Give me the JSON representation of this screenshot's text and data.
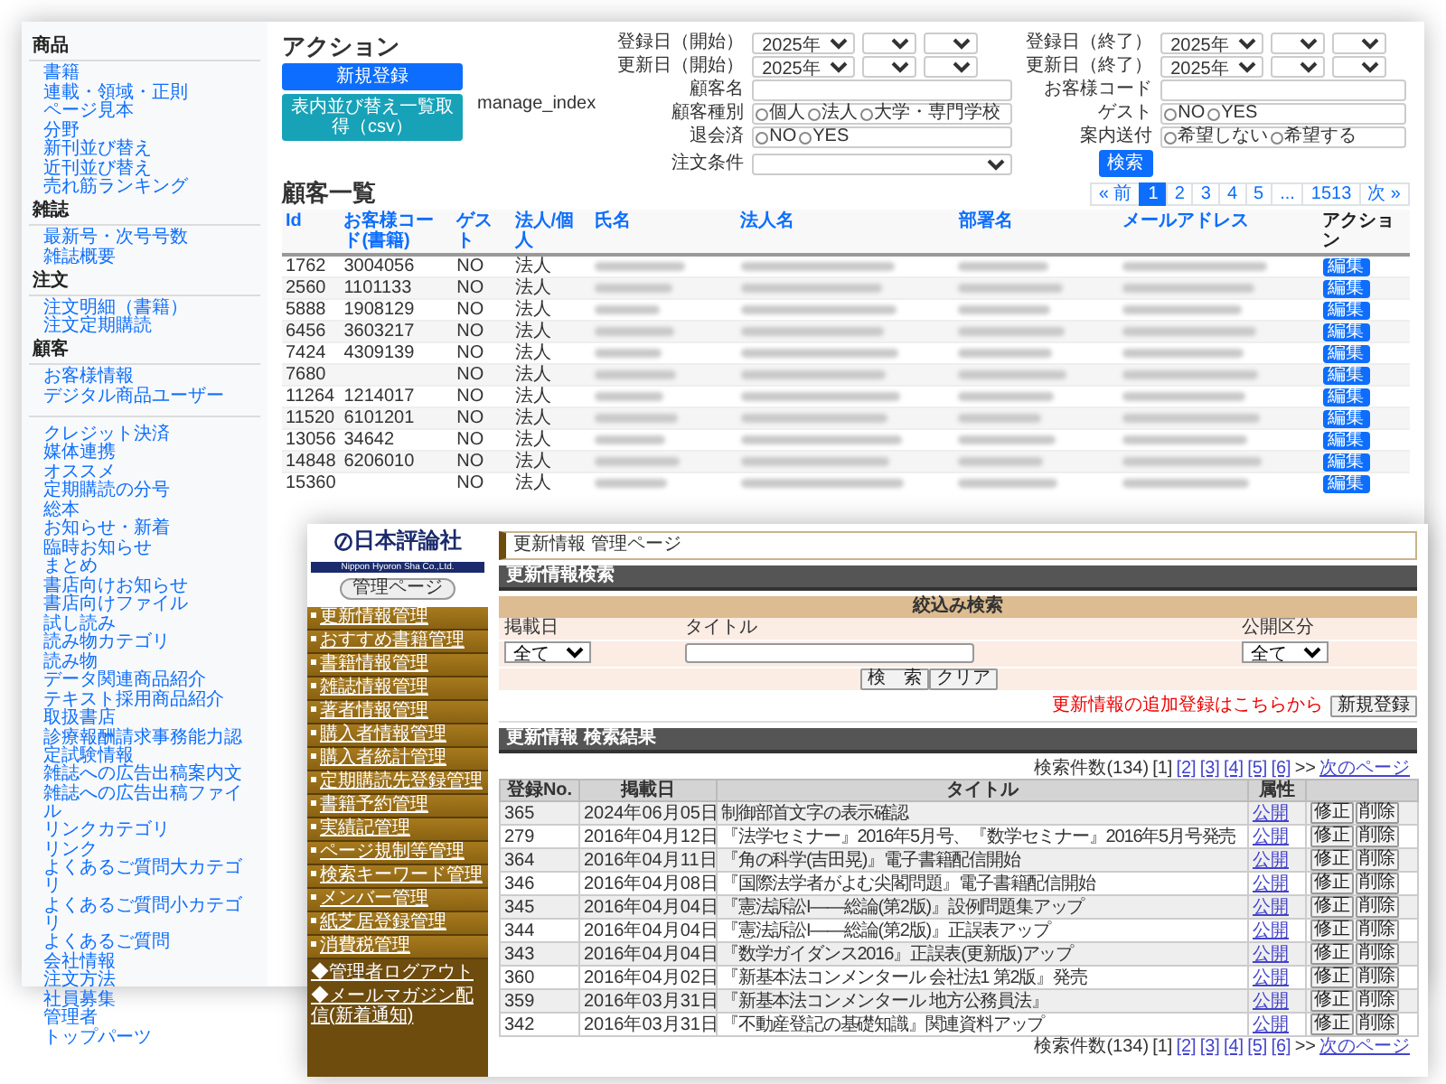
{
  "back_window": {
    "sidebar": [
      {
        "heading": "商品",
        "items": [
          "書籍",
          "連載・領域・正則",
          "ページ見本",
          "分野",
          "新刊並び替え",
          "近刊並び替え",
          "売れ筋ランキング"
        ]
      },
      {
        "heading": "雑誌",
        "items": [
          "最新号・次号号数",
          "雑誌概要"
        ]
      },
      {
        "heading": "注文",
        "items": [
          "注文明細（書籍）",
          "注文定期購読"
        ]
      },
      {
        "heading": "顧客",
        "items": [
          "お客様情報",
          "デジタル商品ユーザー"
        ]
      },
      {
        "items": [
          "クレジット決済",
          "媒体連携",
          "オススメ",
          "定期購読の分号",
          "総本",
          "お知らせ・新着",
          "臨時お知らせ",
          "まとめ",
          "書店向けお知らせ",
          "書店向けファイル",
          "試し読み",
          "読み物カテゴリ",
          "読み物",
          "データ関連商品紹介",
          "テキスト採用商品紹介",
          "取扱書店",
          "診療報酬請求事務能力認定試験情報",
          "雑誌への広告出稿案内文",
          "雑誌への広告出稿ファイル",
          "リンクカテゴリ",
          "リンク",
          "よくあるご質問大カテゴリ",
          "よくあるご質問小カテゴリ",
          "よくあるご質問",
          "会社情報",
          "注文方法",
          "社員募集",
          "管理者",
          "トップパーツ"
        ]
      }
    ],
    "title": "アクション",
    "buttons": [
      {
        "label": "新規登録",
        "kind": "primary"
      },
      {
        "label": "表内並び替え一覧取得（csv）",
        "kind": "info"
      }
    ],
    "form_label": "manage_index",
    "form": [
      {
        "label": "登録日（開始）",
        "kind": "date",
        "value": "2025年"
      },
      {
        "label": "登録日（終了）",
        "kind": "date",
        "value": "2025年"
      },
      {
        "label": "更新日（開始）",
        "kind": "date",
        "value": "2025年"
      },
      {
        "label": "更新日（終了）",
        "kind": "date",
        "value": "2025年"
      },
      {
        "label": "顧客名",
        "kind": "text"
      },
      {
        "label": "お客様コード",
        "kind": "text"
      },
      {
        "label": "顧客種別",
        "kind": "radio",
        "options": [
          {
            "label": "個人",
            "checked": false
          },
          {
            "label": "法人",
            "checked": false
          },
          {
            "label": "大学・専門学校",
            "checked": false
          }
        ]
      },
      {
        "label": "ゲスト",
        "kind": "radio",
        "options": [
          {
            "label": "NO",
            "checked": false
          },
          {
            "label": "YES",
            "checked": false
          }
        ]
      },
      {
        "label": "退会済",
        "kind": "radio",
        "options": [
          {
            "label": "NO",
            "checked": false
          },
          {
            "label": "YES",
            "checked": false
          }
        ]
      },
      {
        "label": "案内送付",
        "kind": "radio",
        "options": [
          {
            "label": "希望しない",
            "checked": false
          },
          {
            "label": "希望する",
            "checked": false
          }
        ]
      },
      {
        "label": "注文条件",
        "kind": "select"
      }
    ],
    "search_button": "検索",
    "list_title": "顧客一覧",
    "pagination": [
      {
        "label": "« 前",
        "selected": false
      },
      {
        "label": "1",
        "selected": true
      },
      {
        "label": "2",
        "selected": false
      },
      {
        "label": "3",
        "selected": false
      },
      {
        "label": "4",
        "selected": false
      },
      {
        "label": "5",
        "selected": false
      },
      {
        "label": "...",
        "selected": false
      },
      {
        "label": "1513",
        "selected": false
      },
      {
        "label": "次 »",
        "selected": false
      }
    ],
    "table": {
      "columns": [
        {
          "label": "Id",
          "sortable": true
        },
        {
          "label": "お客様コード(書籍)",
          "sortable": true
        },
        {
          "label": "ゲスト",
          "sortable": true
        },
        {
          "label": "法人/個人",
          "sortable": true
        },
        {
          "label": "氏名",
          "sortable": true,
          "redacted": true
        },
        {
          "label": "法人名",
          "sortable": true,
          "redacted": true
        },
        {
          "label": "部署名",
          "sortable": true,
          "redacted": true
        },
        {
          "label": "メールアドレス",
          "sortable": true,
          "redacted": true
        },
        {
          "label": "アクション",
          "sortable": false
        }
      ],
      "rows": [
        {
          "id": "1762",
          "code": "3004056",
          "guest": "NO",
          "type": "法人",
          "action": "編集"
        },
        {
          "id": "2560",
          "code": "1101133",
          "guest": "NO",
          "type": "法人",
          "action": "編集"
        },
        {
          "id": "5888",
          "code": "1908129",
          "guest": "NO",
          "type": "法人",
          "action": "編集"
        },
        {
          "id": "6456",
          "code": "3603217",
          "guest": "NO",
          "type": "法人",
          "action": "編集"
        },
        {
          "id": "7424",
          "code": "4309139",
          "guest": "NO",
          "type": "法人",
          "action": "編集"
        },
        {
          "id": "7680",
          "guest": "NO",
          "type": "法人",
          "action": "編集"
        },
        {
          "id": "11264",
          "code": "1214017",
          "guest": "NO",
          "type": "法人",
          "action": "編集"
        },
        {
          "id": "11520",
          "code": "6101201",
          "guest": "NO",
          "type": "法人",
          "action": "編集"
        },
        {
          "id": "13056",
          "code": "34642",
          "guest": "NO",
          "type": "法人",
          "action": "編集"
        },
        {
          "id": "14848",
          "code": "6206010",
          "guest": "NO",
          "type": "法人",
          "action": "編集"
        },
        {
          "id": "15360",
          "guest": "NO",
          "type": "法人",
          "action": "編集"
        }
      ]
    }
  },
  "front_window": {
    "logo": {
      "name": "日本評論社",
      "tagline": "Nippon Hyoron Sha Co.,Ltd."
    },
    "admin_button": "管理ページ",
    "menu": [
      "更新情報管理",
      "おすすめ書籍管理",
      "書籍情報管理",
      "雑誌情報管理",
      "著者情報管理",
      "購入者情報管理",
      "購入者統計管理",
      "定期購読先登録管理",
      "書籍予約管理",
      "実績記管理",
      "ページ規制等管理",
      "検索キーワード管理",
      "メンバー管理",
      "紙芝居登録管理",
      "消費税管理"
    ],
    "links": [
      "◆管理者ログアウト",
      "◆メールマガジン配信(新着通知)"
    ],
    "page_title": "更新情報 管理ページ",
    "search_bar": "更新情報検索",
    "search": {
      "heading": "絞込み検索",
      "date_label": "掲載日",
      "date_value": "全て",
      "title_label": "タイトル",
      "status_label": "公開区分",
      "status_value": "全て",
      "buttons": [
        "検　索",
        "クリア"
      ]
    },
    "register_note": "更新情報の追加登録はこちらから",
    "register_button": "新規登録",
    "results_bar": "更新情報 検索結果",
    "pager_top": {
      "count": "検索件数(134)",
      "pages": [
        {
          "label": "[1]",
          "selected": true
        },
        {
          "label": "[2]",
          "selected": false
        },
        {
          "label": "[3]",
          "selected": false
        },
        {
          "label": "[4]",
          "selected": false
        },
        {
          "label": "[5]",
          "selected": false
        },
        {
          "label": "[6]",
          "selected": false
        }
      ],
      "sep": ">>",
      "next": "次のページ"
    },
    "table": {
      "columns": [
        "登録No.",
        "掲載日",
        "タイトル",
        "属性"
      ],
      "rows": [
        {
          "no": "365",
          "date": "2024年06月05日",
          "title": "制御部首文字の表示確認",
          "status": "公開",
          "actions": [
            "修正",
            "削除"
          ]
        },
        {
          "no": "279",
          "date": "2016年04月12日",
          "title": "『法学セミナー』2016年5月号、『数学セミナー』2016年5月号発売",
          "status": "公開",
          "actions": [
            "修正",
            "削除"
          ]
        },
        {
          "no": "364",
          "date": "2016年04月11日",
          "title": "『角の科学(吉田晃)』電子書籍配信開始",
          "status": "公開",
          "actions": [
            "修正",
            "削除"
          ]
        },
        {
          "no": "346",
          "date": "2016年04月08日",
          "title": "『国際法学者がよむ尖閣問題』電子書籍配信開始",
          "status": "公開",
          "actions": [
            "修正",
            "削除"
          ]
        },
        {
          "no": "345",
          "date": "2016年04月04日",
          "title": "『憲法訴訟I——総論(第2版)』設例問題集アップ",
          "status": "公開",
          "actions": [
            "修正",
            "削除"
          ]
        },
        {
          "no": "344",
          "date": "2016年04月04日",
          "title": "『憲法訴訟I——総論(第2版)』正誤表アップ",
          "status": "公開",
          "actions": [
            "修正",
            "削除"
          ]
        },
        {
          "no": "343",
          "date": "2016年04月04日",
          "title": "『数学ガイダンス2016』正誤表(更新版)アップ",
          "status": "公開",
          "actions": [
            "修正",
            "削除"
          ]
        },
        {
          "no": "360",
          "date": "2016年04月02日",
          "title": "『新基本法コンメンタール 会社法1 第2版』発売",
          "status": "公開",
          "actions": [
            "修正",
            "削除"
          ]
        },
        {
          "no": "359",
          "date": "2016年03月31日",
          "title": "『新基本法コンメンタール 地方公務員法』",
          "status": "公開",
          "actions": [
            "修正",
            "削除"
          ]
        },
        {
          "no": "342",
          "date": "2016年03月31日",
          "title": "『不動産登記の基礎知識』関連資料アップ",
          "status": "公開",
          "actions": [
            "修正",
            "削除"
          ]
        }
      ]
    },
    "pager_bottom": {
      "count": "検索件数(134)",
      "pages": [
        {
          "label": "[1]",
          "selected": true
        },
        {
          "label": "[2]",
          "selected": false
        },
        {
          "label": "[3]",
          "selected": false
        },
        {
          "label": "[4]",
          "selected": false
        },
        {
          "label": "[5]",
          "selected": false
        },
        {
          "label": "[6]",
          "selected": false
        }
      ],
      "sep": ">>",
      "next": "次のページ"
    }
  }
}
